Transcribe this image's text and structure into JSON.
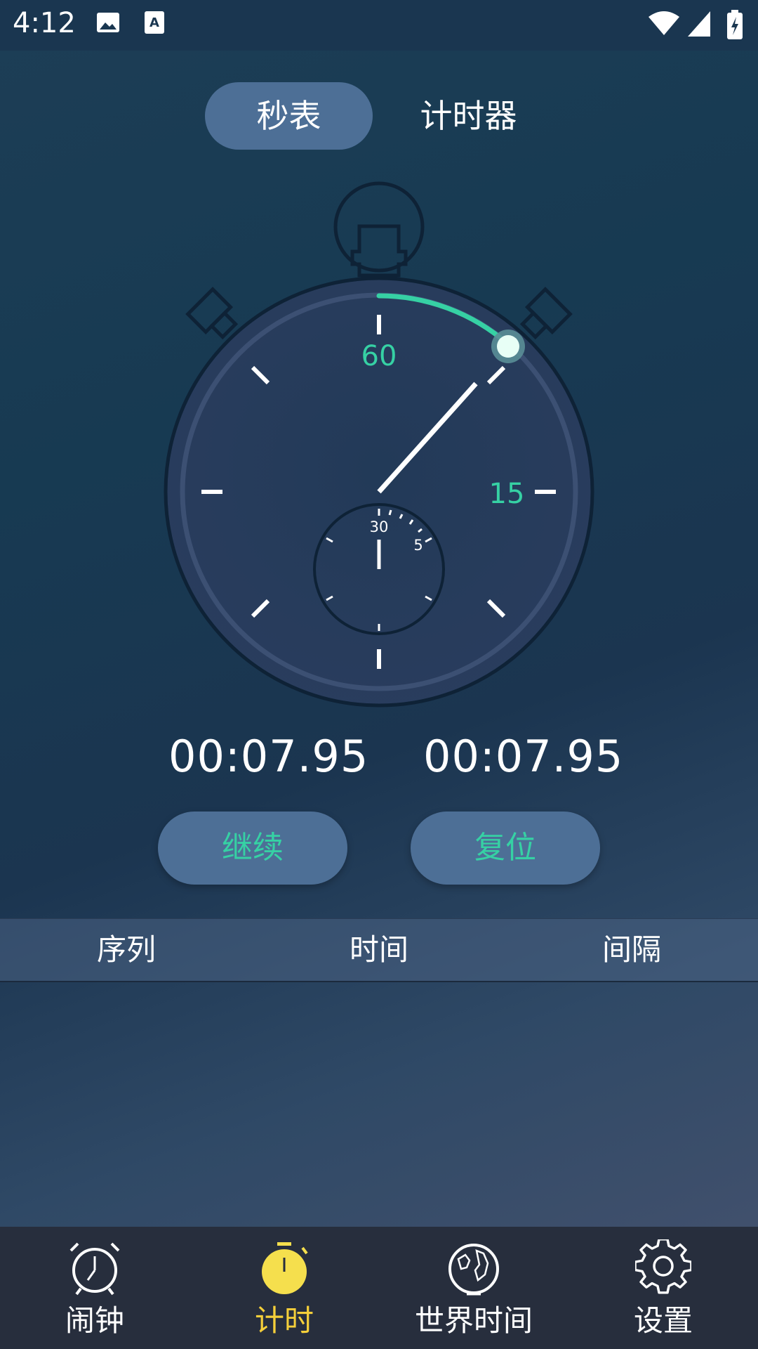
{
  "status_bar": {
    "time": "4:12",
    "icons": [
      "image-icon",
      "text-input-icon",
      "wifi-icon",
      "signal-icon",
      "battery-charging-icon"
    ]
  },
  "tabs": [
    {
      "label": "秒表",
      "active": true
    },
    {
      "label": "计时器",
      "active": false
    }
  ],
  "dial": {
    "labels": {
      "top": "60",
      "right": "15"
    },
    "sub_labels": {
      "top": "30",
      "right": "5"
    },
    "accent_color": "#36d1a4",
    "progress_seconds": 7.95
  },
  "readouts": {
    "total": "00:07.95",
    "lap": "00:07.95"
  },
  "buttons": {
    "continue": "继续",
    "reset": "复位"
  },
  "lap_table": {
    "headers": [
      "序列",
      "时间",
      "间隔"
    ],
    "rows": []
  },
  "bottom_nav": [
    {
      "label": "闹钟",
      "icon": "alarm-clock-icon",
      "active": false
    },
    {
      "label": "计时",
      "icon": "stopwatch-icon",
      "active": true
    },
    {
      "label": "世界时间",
      "icon": "globe-icon",
      "active": false
    },
    {
      "label": "设置",
      "icon": "gear-icon",
      "active": false
    }
  ],
  "colors": {
    "accent": "#36d1a4",
    "active_nav": "#f5cf3a",
    "button_bg": "#4d6f96"
  }
}
